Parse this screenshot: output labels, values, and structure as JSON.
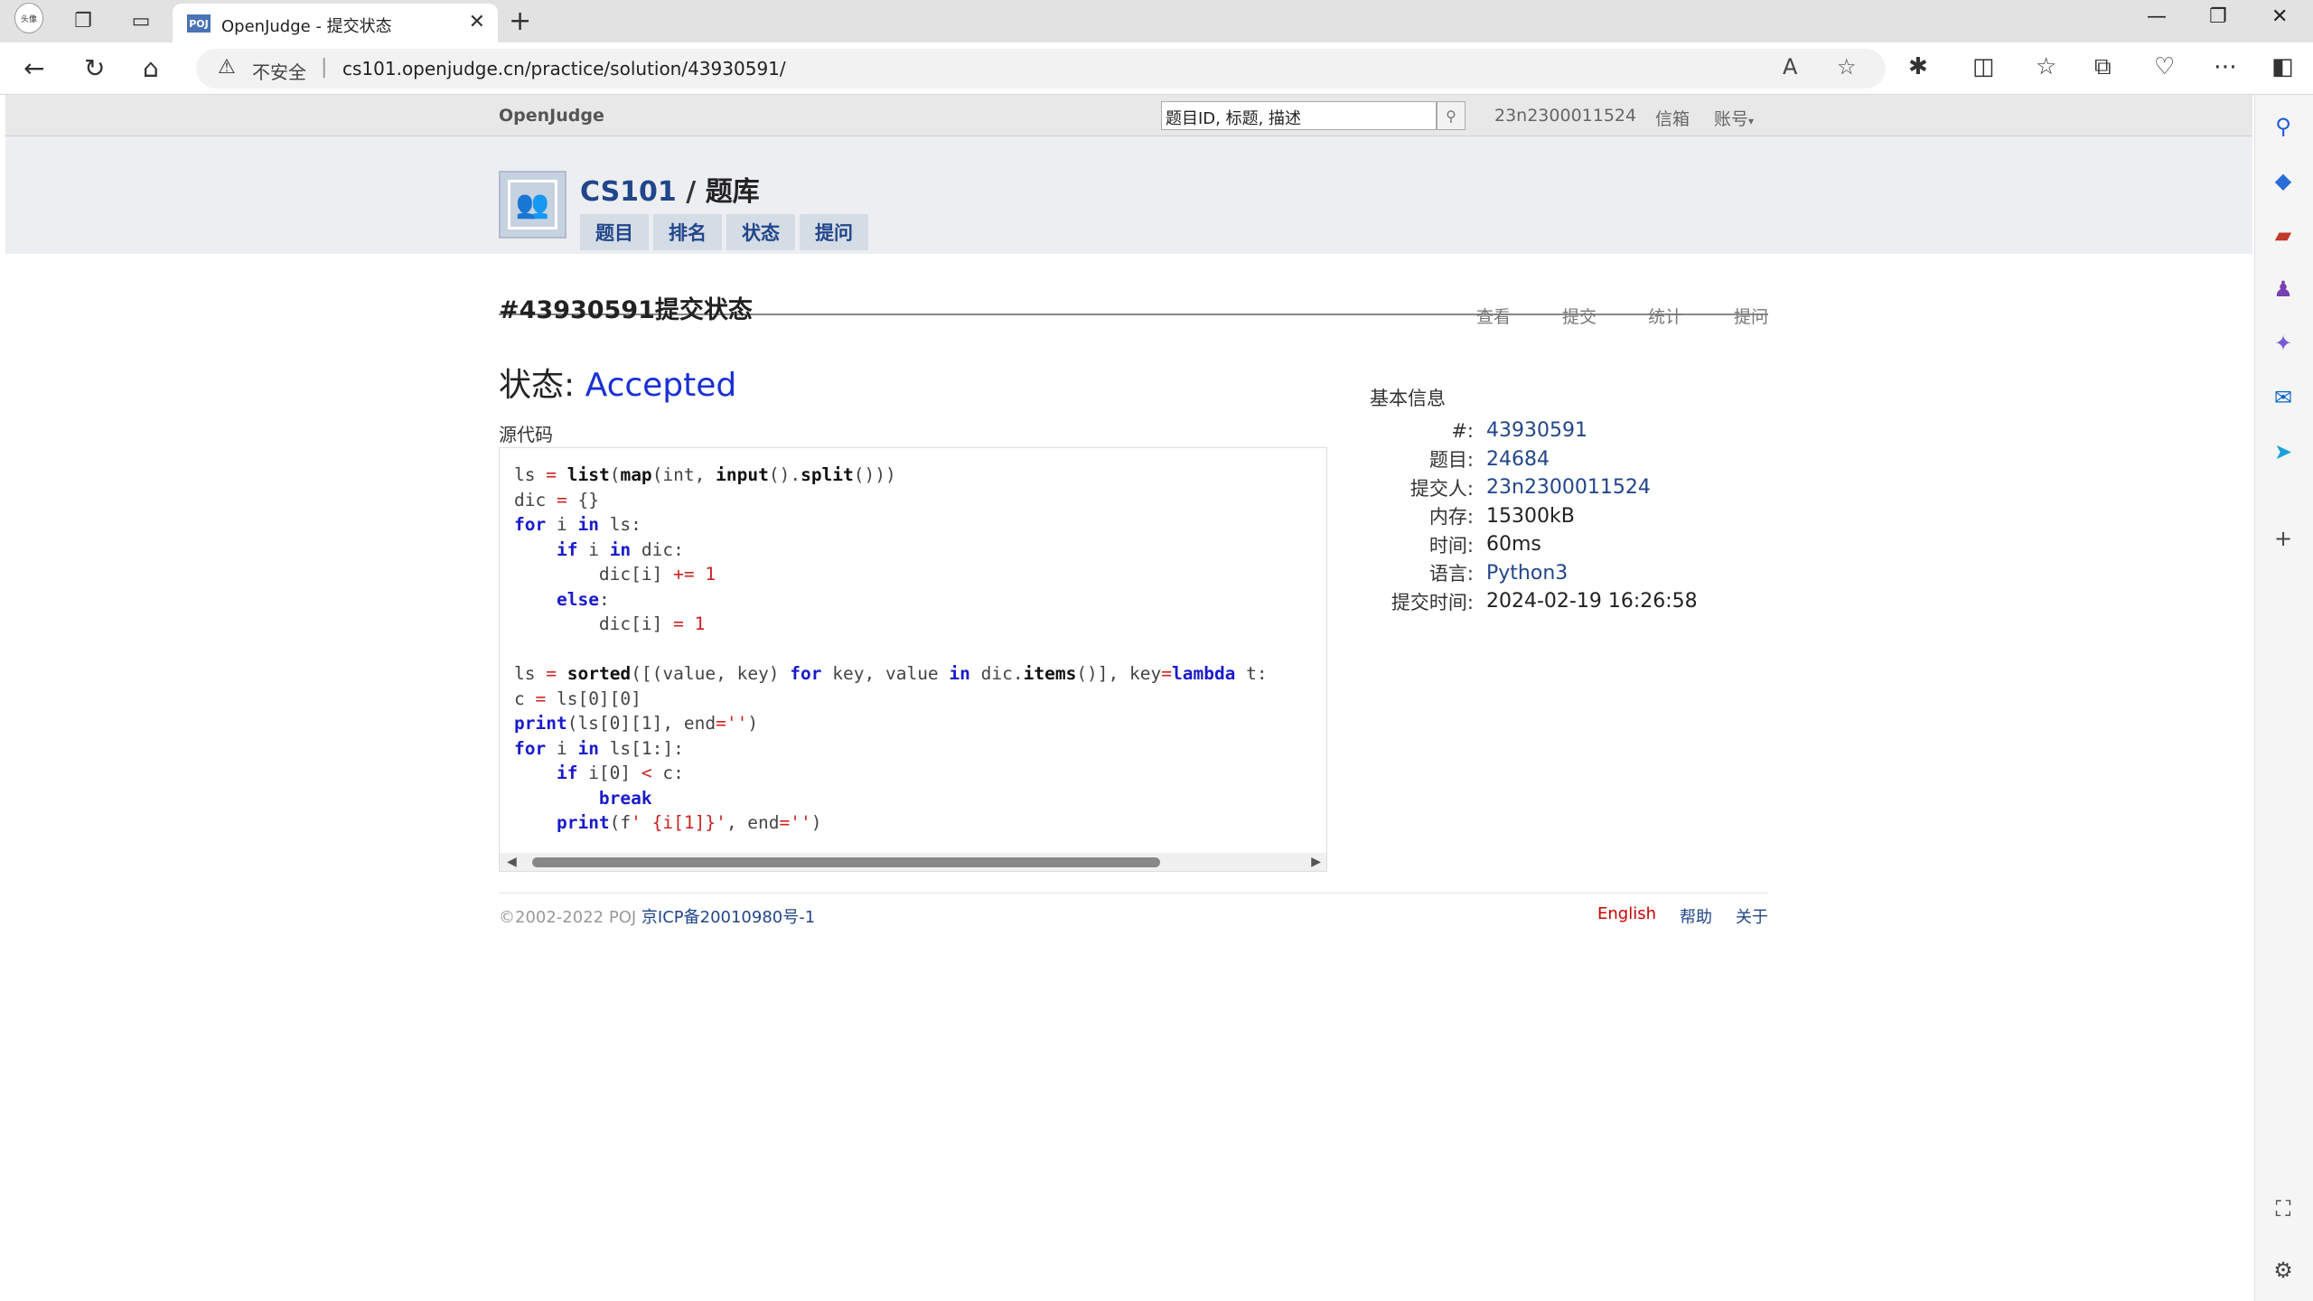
{
  "browser": {
    "tab_title": "OpenJudge - 提交状态",
    "tab_favicon": "POJ",
    "address": {
      "security_label": "不安全",
      "url": "cs101.openjudge.cn/practice/solution/43930591/"
    },
    "profile_label": "头像"
  },
  "site": {
    "brand": "OpenJudge",
    "search_placeholder": "题目ID, 标题, 描述",
    "user": "23n2300011524",
    "mail": "信箱",
    "account": "账号"
  },
  "group": {
    "name": "CS101",
    "separator": "/",
    "section": "题库",
    "tabs": [
      "题目",
      "排名",
      "状态",
      "提问"
    ]
  },
  "solution": {
    "heading": "#43930591提交状态",
    "actions": [
      "查看",
      "提交",
      "统计",
      "提问"
    ],
    "status_label": "状态: ",
    "status_value": "Accepted",
    "source_label": "源代码"
  },
  "info": {
    "title": "基本信息",
    "rows": [
      {
        "key": "#:",
        "value": "43930591",
        "link": true
      },
      {
        "key": "题目:",
        "value": "24684",
        "link": true
      },
      {
        "key": "提交人:",
        "value": "23n2300011524",
        "link": true
      },
      {
        "key": "内存:",
        "value": "15300kB",
        "link": false
      },
      {
        "key": "时间:",
        "value": "60ms",
        "link": false
      },
      {
        "key": "语言:",
        "value": "Python3",
        "link": true
      },
      {
        "key": "提交时间:",
        "value": "2024-02-19 16:26:58",
        "link": false
      }
    ]
  },
  "footer": {
    "copyright": "©2002-2022 POJ ",
    "icp": "京ICP备20010980号-1",
    "links": [
      "English",
      "帮助",
      "关于"
    ]
  },
  "colors": {
    "accent": "#22468a",
    "accepted": "#1a2fd6",
    "english_link": "#cc0000"
  }
}
